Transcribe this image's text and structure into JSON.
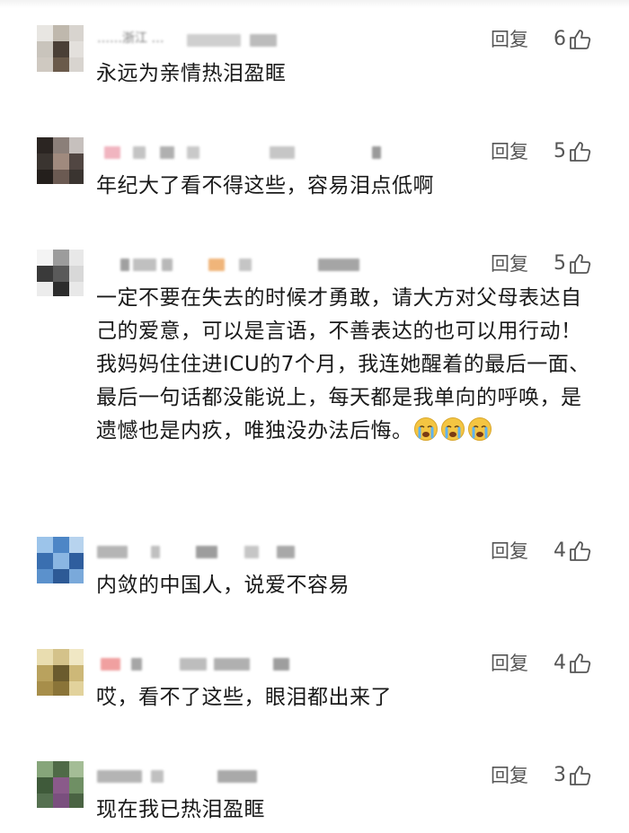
{
  "reply_label": "回复",
  "comments": [
    {
      "meta_text": "……浙江 …",
      "like_count": "6",
      "body": "永远为亲情热泪盈眶"
    },
    {
      "meta_text": "",
      "like_count": "5",
      "body": "年纪大了看不得这些，容易泪点低啊"
    },
    {
      "meta_text": "",
      "like_count": "5",
      "body": "一定不要在失去的时候才勇敢，请大方对父母表达自己的爱意，可以是言语，不善表达的也可以用行动！我妈妈住住进ICU的7个月，我连她醒着的最后一面、最后一句话都没能说上，每天都是我单向的呼唤，是遗憾也是内疚，唯独没办法后悔。",
      "emoji": [
        "crying-face",
        "crying-face",
        "crying-face"
      ]
    },
    {
      "meta_text": "",
      "like_count": "4",
      "body": "内敛的中国人，说爱不容易"
    },
    {
      "meta_text": "",
      "like_count": "4",
      "body": "哎，看不了这些，眼泪都出来了"
    },
    {
      "meta_text": "",
      "like_count": "3",
      "body": "现在我已热泪盈眶"
    }
  ],
  "colors": {
    "text": "#1a1a1a",
    "muted": "#555555",
    "emoji_face": "#f4c542"
  }
}
